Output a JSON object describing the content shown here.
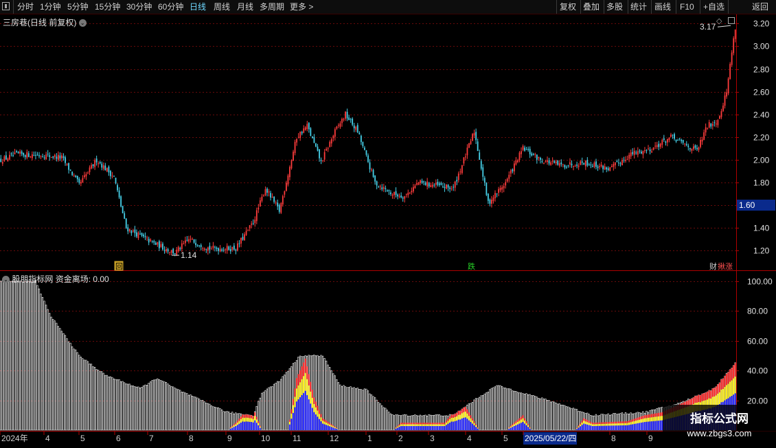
{
  "toolbar": {
    "left": [
      "分时",
      "1分钟",
      "5分钟",
      "15分钟",
      "30分钟",
      "60分钟",
      "日线",
      "周线",
      "月线",
      "多周期",
      "更多 >"
    ],
    "active_index": 6,
    "right": [
      "复权",
      "叠加",
      "多股",
      "统计",
      "画线",
      "F10",
      "+自选",
      "返回"
    ]
  },
  "price_panel": {
    "title": "三房巷(日线 前复权)",
    "y_ticks": [
      "3.20",
      "3.00",
      "2.80",
      "2.60",
      "2.40",
      "2.20",
      "2.00",
      "1.80",
      "1.60",
      "1.40",
      "1.20"
    ],
    "y_min": 1.1,
    "y_max": 3.25,
    "current_price": "1.60",
    "high_label": "3.17",
    "low_label": "1.14",
    "markers": [
      {
        "text": "回",
        "bg": "#c9a227",
        "fg": "#000"
      },
      {
        "text": "跌",
        "bg": "#000",
        "fg": "#27d027"
      },
      {
        "text": "财",
        "bg": "#000",
        "fg": "#d0d0d0"
      },
      {
        "text": "揪涨",
        "bg": "#000",
        "fg": "#ff5050"
      }
    ]
  },
  "indicator_panel": {
    "name": "股朋指标网",
    "label": "资金离场: 0.00",
    "y_ticks": [
      "100.00",
      "80.00",
      "60.00",
      "40.00",
      "20.00"
    ],
    "y_min": 0,
    "y_max": 105
  },
  "date_axis": [
    "2024年",
    "4",
    "5",
    "6",
    "7",
    "8",
    "9",
    "10",
    "11",
    "12",
    "1",
    "2",
    "3",
    "4",
    "5",
    "2025/05/22/四",
    "8",
    "9"
  ],
  "watermark": {
    "line1": "指标公式网",
    "line2": "www.zbgs3.com"
  },
  "colors": {
    "up": "#ff3c3c",
    "down": "#46d0e8",
    "grid": "#6a0a0a",
    "axis": "#b00000",
    "red": "#ff1010",
    "yellow": "#ffee00",
    "blue": "#1010ff",
    "white": "#ffffff"
  },
  "chart_data": {
    "type": "candlestick",
    "anchors_day_close": [
      [
        0,
        2.0
      ],
      [
        10,
        2.05
      ],
      [
        25,
        2.04
      ],
      [
        35,
        2.02
      ],
      [
        45,
        1.78
      ],
      [
        55,
        2.0
      ],
      [
        65,
        1.85
      ],
      [
        72,
        1.4
      ],
      [
        86,
        1.28
      ],
      [
        100,
        1.18
      ],
      [
        108,
        1.3
      ],
      [
        120,
        1.22
      ],
      [
        135,
        1.22
      ],
      [
        145,
        1.45
      ],
      [
        152,
        1.75
      ],
      [
        160,
        1.55
      ],
      [
        170,
        2.2
      ],
      [
        176,
        2.3
      ],
      [
        184,
        1.98
      ],
      [
        192,
        2.25
      ],
      [
        198,
        2.4
      ],
      [
        205,
        2.25
      ],
      [
        215,
        1.8
      ],
      [
        225,
        1.7
      ],
      [
        232,
        1.68
      ],
      [
        240,
        1.8
      ],
      [
        260,
        1.75
      ],
      [
        272,
        2.25
      ],
      [
        280,
        1.62
      ],
      [
        290,
        1.8
      ],
      [
        300,
        2.1
      ],
      [
        310,
        2.0
      ],
      [
        322,
        1.95
      ],
      [
        335,
        1.98
      ],
      [
        350,
        1.92
      ],
      [
        362,
        2.05
      ],
      [
        374,
        2.1
      ],
      [
        385,
        2.2
      ],
      [
        400,
        2.08
      ],
      [
        406,
        2.3
      ],
      [
        412,
        2.35
      ],
      [
        417,
        2.6
      ],
      [
        420,
        2.95
      ],
      [
        422,
        3.17
      ]
    ],
    "indicator_anchors_white": [
      [
        0,
        100
      ],
      [
        20,
        100
      ],
      [
        28,
        78
      ],
      [
        45,
        50
      ],
      [
        60,
        37
      ],
      [
        80,
        28
      ],
      [
        90,
        35
      ],
      [
        100,
        28
      ],
      [
        130,
        12
      ],
      [
        145,
        10
      ],
      [
        150,
        25
      ],
      [
        160,
        33
      ],
      [
        172,
        50
      ],
      [
        185,
        50
      ],
      [
        195,
        30
      ],
      [
        210,
        27
      ],
      [
        225,
        10
      ],
      [
        260,
        10
      ],
      [
        272,
        20
      ],
      [
        285,
        30
      ],
      [
        300,
        25
      ],
      [
        320,
        18
      ],
      [
        340,
        10
      ],
      [
        370,
        12
      ],
      [
        390,
        18
      ],
      [
        410,
        28
      ],
      [
        422,
        45
      ]
    ],
    "indicator_anchors_colored": [
      [
        0,
        0
      ],
      [
        130,
        0
      ],
      [
        135,
        5
      ],
      [
        140,
        12
      ],
      [
        145,
        15
      ],
      [
        150,
        0
      ],
      [
        165,
        0
      ],
      [
        170,
        35
      ],
      [
        175,
        48
      ],
      [
        180,
        22
      ],
      [
        185,
        8
      ],
      [
        195,
        0
      ],
      [
        225,
        0
      ],
      [
        230,
        5
      ],
      [
        240,
        5
      ],
      [
        255,
        5
      ],
      [
        260,
        12
      ],
      [
        265,
        20
      ],
      [
        270,
        10
      ],
      [
        275,
        0
      ],
      [
        290,
        0
      ],
      [
        300,
        10
      ],
      [
        305,
        0
      ],
      [
        330,
        0
      ],
      [
        335,
        8
      ],
      [
        340,
        5
      ],
      [
        360,
        6
      ],
      [
        370,
        10
      ],
      [
        380,
        12
      ],
      [
        395,
        20
      ],
      [
        405,
        28
      ],
      [
        415,
        35
      ],
      [
        422,
        45
      ]
    ]
  }
}
